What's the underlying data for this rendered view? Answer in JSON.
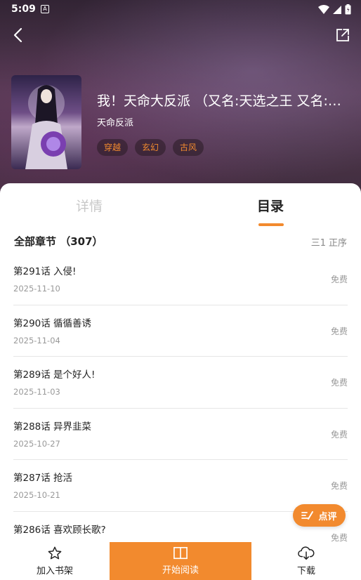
{
  "status_bar": {
    "time": "5:09",
    "app_icon_glyph": "A"
  },
  "book": {
    "title": "我！天命大反派 （又名:天选之王 又名:…",
    "author": "天命反派",
    "tags": [
      "穿越",
      "玄幻",
      "古风"
    ]
  },
  "tabs": {
    "details": "详情",
    "catalog": "目录"
  },
  "catalog": {
    "section_title": "全部章节 （307）",
    "sort_icon": "三1",
    "sort_label": "正序",
    "chapters": [
      {
        "title": "第291话 入侵!",
        "date": "2025-11-10",
        "price": "免费"
      },
      {
        "title": "第290话 循循善诱",
        "date": "2025-11-04",
        "price": "免费"
      },
      {
        "title": "第289话 是个好人!",
        "date": "2025-11-03",
        "price": "免费"
      },
      {
        "title": "第288话 异界韭菜",
        "date": "2025-10-27",
        "price": "免费"
      },
      {
        "title": "第287话 抢活",
        "date": "2025-10-21",
        "price": "免费"
      },
      {
        "title": "第286话 喜欢顾长歌?",
        "date": "",
        "price": "免费"
      }
    ]
  },
  "review_button": "点评",
  "bottom_bar": {
    "shelf": "加入书架",
    "read": "开始阅读",
    "download": "下载"
  },
  "colors": {
    "accent": "#f28a2e"
  }
}
